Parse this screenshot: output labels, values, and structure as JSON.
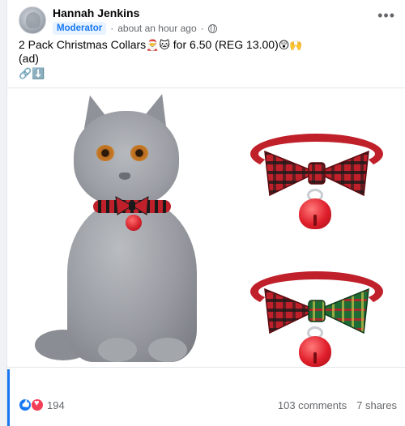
{
  "post": {
    "author": "Hannah Jenkins",
    "badge": "Moderator",
    "time": "about an hour ago",
    "separator": "·",
    "text_line1_a": "2 Pack Christmas Collars",
    "emoji_1": "🎅🐱",
    "text_line1_b": " for 6.50 (REG 13.00)",
    "emoji_2": "😲🙌",
    "text_line2": "(ad)",
    "link_icons": "🔗⬇️"
  },
  "media": {
    "alt": "Grey cat wearing red tartan bow collar with bell, plus two collar products"
  },
  "footer": {
    "reaction_count": "194",
    "comments": "103 comments",
    "shares": "7 shares"
  },
  "colors": {
    "accent": "#1877f2",
    "badge_bg": "#e7f3ff",
    "collar_red": "#c0202a",
    "collar_green": "#1f6b34"
  },
  "icons": [
    "more-options-icon",
    "globe-icon",
    "like-reaction-icon",
    "love-reaction-icon"
  ]
}
